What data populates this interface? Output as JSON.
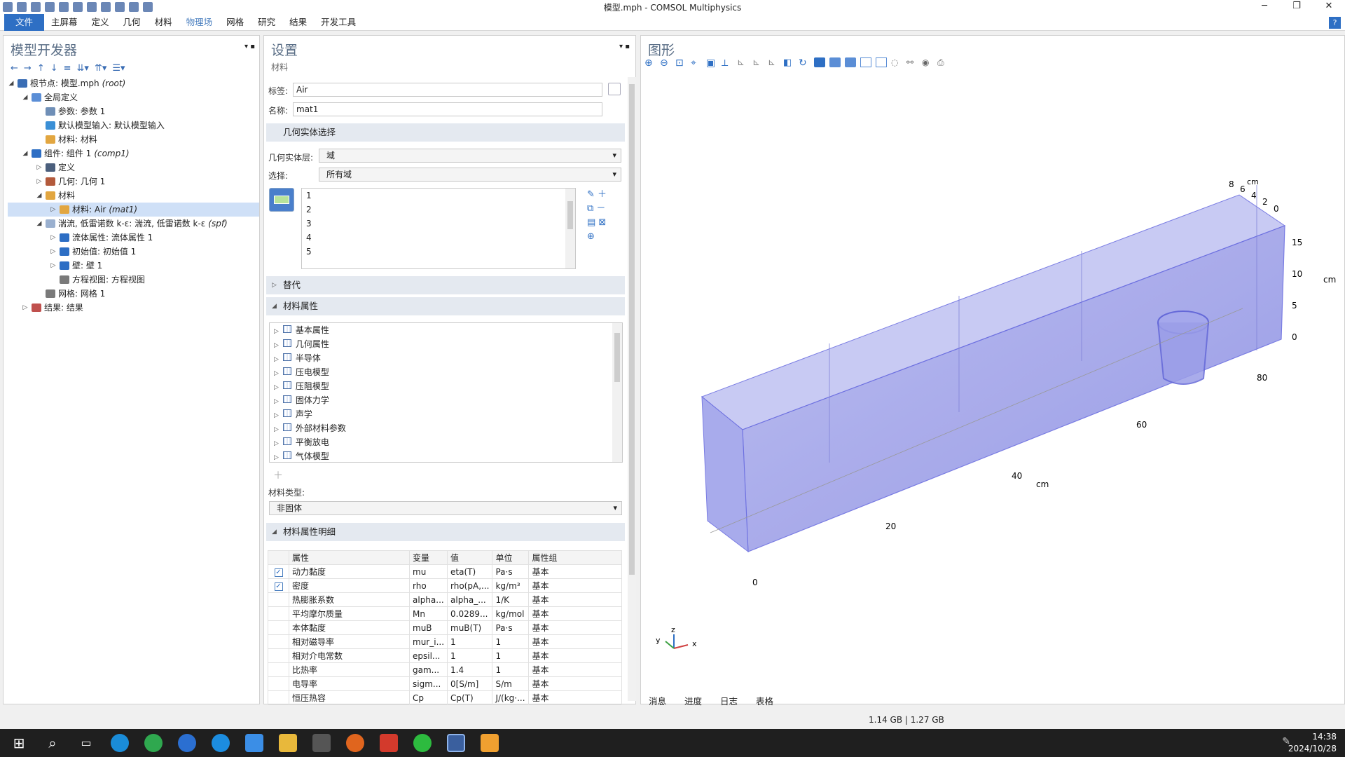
{
  "window": {
    "title": "模型.mph - COMSOL Multiphysics"
  },
  "menu": [
    "文件",
    "主屏幕",
    "定义",
    "几何",
    "材料",
    "物理场",
    "网格",
    "研究",
    "结果",
    "开发工具"
  ],
  "model_builder": {
    "title": "模型开发器",
    "tree": [
      {
        "label": "根节点: 模型.mph",
        "tag": "(root)",
        "level": 0,
        "twisty": "◢",
        "icon_color": "#3a6db4"
      },
      {
        "label": "全局定义",
        "level": 1,
        "twisty": "◢",
        "icon_color": "#5b8ed6"
      },
      {
        "label": "参数: 参数 1",
        "level": 2,
        "twisty": "",
        "icon_color": "#6f8fb7"
      },
      {
        "label": "默认模型输入: 默认模型输入",
        "level": 2,
        "twisty": "",
        "icon_color": "#3a8fd6"
      },
      {
        "label": "材料: 材料",
        "level": 2,
        "twisty": "",
        "icon_color": "#e2a640"
      },
      {
        "label": "组件: 组件 1",
        "tag": "(comp1)",
        "level": 1,
        "twisty": "◢",
        "icon_color": "#2d6ec4"
      },
      {
        "label": "定义",
        "level": 2,
        "twisty": "▷",
        "icon_color": "#4b5f7d"
      },
      {
        "label": "几何: 几何 1",
        "level": 2,
        "twisty": "▷",
        "icon_color": "#b35a3c"
      },
      {
        "label": "材料",
        "level": 2,
        "twisty": "◢",
        "icon_color": "#e2a640"
      },
      {
        "label": "材料: Air",
        "tag": "(mat1)",
        "level": 3,
        "twisty": "▷",
        "icon_color": "#e2a640",
        "selected": true
      },
      {
        "label": "湍流, 低雷诺数 k-ε: 湍流, 低雷诺数 k-ε",
        "tag": "(spf)",
        "level": 2,
        "twisty": "◢",
        "icon_color": "#9ab0cf"
      },
      {
        "label": "流体属性: 流体属性 1",
        "level": 3,
        "twisty": "▷",
        "icon_color": "#2d6ec4"
      },
      {
        "label": "初始值: 初始值 1",
        "level": 3,
        "twisty": "▷",
        "icon_color": "#2d6ec4"
      },
      {
        "label": "壁: 壁 1",
        "level": 3,
        "twisty": "▷",
        "icon_color": "#2d6ec4"
      },
      {
        "label": "方程视图: 方程视图",
        "level": 3,
        "twisty": "",
        "icon_color": "#7a7a7a"
      },
      {
        "label": "网格: 网格 1",
        "level": 2,
        "twisty": "",
        "icon_color": "#7a7a7a"
      },
      {
        "label": "结果: 结果",
        "level": 1,
        "twisty": "▷",
        "icon_color": "#c0504d"
      }
    ]
  },
  "settings": {
    "title": "设置",
    "subtitle": "材料",
    "label_lbl": "标签:",
    "label_val": "Air",
    "name_lbl": "名称:",
    "name_val": "mat1",
    "geo_section": "几何实体选择",
    "geo_level_lbl": "几何实体层:",
    "geo_level_val": "域",
    "selection_lbl": "选择:",
    "selection_val": "所有域",
    "domain_list": [
      "1",
      "2",
      "3",
      "4",
      "5"
    ],
    "override_section": "替代",
    "props_section": "材料属性",
    "props_list": [
      "基本属性",
      "几何属性",
      "半导体",
      "压电模型",
      "压阻模型",
      "固体力学",
      "声学",
      "外部材料参数",
      "平衡放电",
      "气体模型"
    ],
    "material_type_lbl": "材料类型:",
    "material_type_val": "非固体",
    "detail_section": "材料属性明细",
    "table_headers": [
      "属性",
      "变量",
      "值",
      "单位",
      "属性组"
    ],
    "table_rows": [
      {
        "check": true,
        "prop": "动力黏度",
        "var": "mu",
        "val": "eta(T)",
        "unit": "Pa·s",
        "group": "基本"
      },
      {
        "check": true,
        "prop": "密度",
        "var": "rho",
        "val": "rho(pA,...",
        "unit": "kg/m³",
        "group": "基本"
      },
      {
        "check": false,
        "prop": "热膨胀系数",
        "var": "alpha...",
        "val": "alpha_...",
        "unit": "1/K",
        "group": "基本"
      },
      {
        "check": false,
        "prop": "平均摩尔质量",
        "var": "Mn",
        "val": "0.0289...",
        "unit": "kg/mol",
        "group": "基本"
      },
      {
        "check": false,
        "prop": "本体黏度",
        "var": "muB",
        "val": "muB(T)",
        "unit": "Pa·s",
        "group": "基本"
      },
      {
        "check": false,
        "prop": "相对磁导率",
        "var": "mur_i...",
        "val": "1",
        "unit": "1",
        "group": "基本"
      },
      {
        "check": false,
        "prop": "相对介电常数",
        "var": "epsil...",
        "val": "1",
        "unit": "1",
        "group": "基本"
      },
      {
        "check": false,
        "prop": "比热率",
        "var": "gam...",
        "val": "1.4",
        "unit": "1",
        "group": "基本"
      },
      {
        "check": false,
        "prop": "电导率",
        "var": "sigm...",
        "val": "0[S/m]",
        "unit": "S/m",
        "group": "基本"
      },
      {
        "check": false,
        "prop": "恒压热容",
        "var": "Cp",
        "val": "Cp(T)",
        "unit": "J/(kg·...",
        "group": "基本"
      }
    ]
  },
  "graphics": {
    "title": "图形",
    "axis_labels": [
      "0",
      "20",
      "40",
      "60",
      "80",
      "cm",
      "0",
      "5",
      "10",
      "15",
      "cm",
      "0",
      "2",
      "4",
      "6",
      "8",
      "cm"
    ],
    "triad": [
      "z",
      "y",
      "x"
    ],
    "tabs": [
      "消息",
      "进度",
      "日志",
      "表格"
    ]
  },
  "status": {
    "memory": "1.14 GB | 1.27 GB"
  },
  "taskbar": {
    "time": "14:38",
    "date": "2024/10/28"
  }
}
